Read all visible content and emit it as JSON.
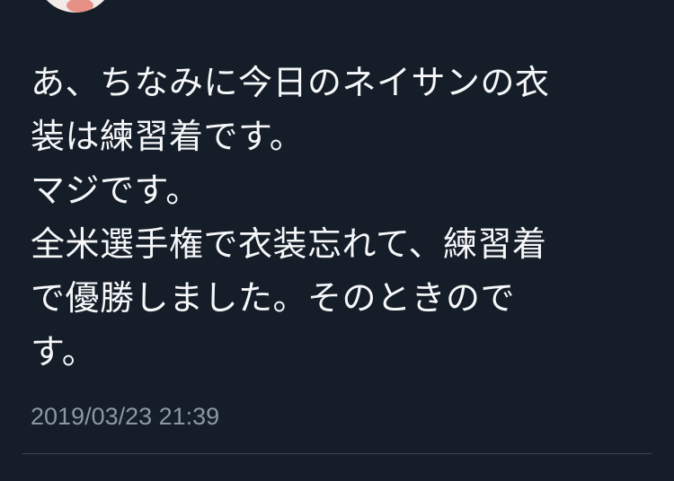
{
  "tweet": {
    "avatar_icon": "user-avatar",
    "text_lines": [
      "あ、ちなみに今日のネイサンの衣",
      "装は練習着です。",
      "マジです。",
      "全米選手権で衣装忘れて、練習着",
      "で優勝しました。そのときので",
      "す。"
    ],
    "timestamp": "2019/03/23 21:39"
  },
  "colors": {
    "background": "#151d28",
    "text": "#f5f7f9",
    "timestamp": "#8b97a4",
    "divider": "#3a4552"
  }
}
